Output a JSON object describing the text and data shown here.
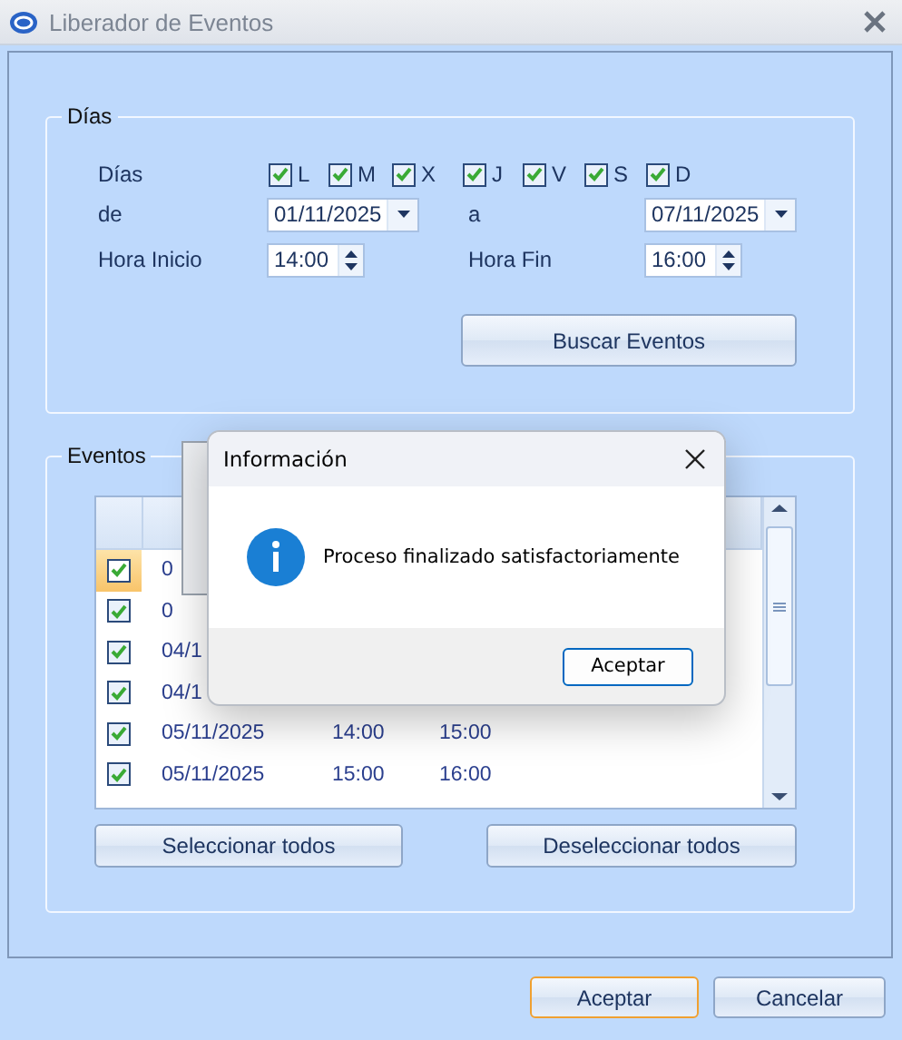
{
  "window": {
    "title": "Liberador de Eventos"
  },
  "dias_group": {
    "title": "Días",
    "days_label": "Días",
    "days": [
      {
        "label": "L",
        "checked": true
      },
      {
        "label": "M",
        "checked": true
      },
      {
        "label": "X",
        "checked": true
      },
      {
        "label": "J",
        "checked": true
      },
      {
        "label": "V",
        "checked": true
      },
      {
        "label": "S",
        "checked": true
      },
      {
        "label": "D",
        "checked": true
      }
    ],
    "from_label": "de",
    "from_date": "01/11/2025",
    "to_label": "a",
    "to_date": "07/11/2025",
    "start_label": "Hora Inicio",
    "start_time": "14:00",
    "end_label": "Hora Fin",
    "end_time": "16:00",
    "search_button": "Buscar Eventos"
  },
  "eventos_group": {
    "title": "Eventos",
    "rows": [
      {
        "selected": true,
        "checked": true,
        "date": "0"
      },
      {
        "selected": false,
        "checked": true,
        "date": "0"
      },
      {
        "selected": false,
        "checked": true,
        "date": "04/1"
      },
      {
        "selected": false,
        "checked": true,
        "date": "04/1"
      },
      {
        "selected": false,
        "checked": true,
        "date": "05/11/2025",
        "start": "14:00",
        "end": "15:00"
      },
      {
        "selected": false,
        "checked": true,
        "date": "05/11/2025",
        "start": "15:00",
        "end": "16:00"
      }
    ],
    "select_all_button": "Seleccionar todos",
    "deselect_all_button": "Deseleccionar todos"
  },
  "footer_buttons": [
    {
      "label": "Aceptar",
      "focused": true
    },
    {
      "label": "Cancelar",
      "focused": false
    }
  ],
  "message_box": {
    "title": "Información",
    "message": "Proceso finalizado satisfactoriamente",
    "button": "Aceptar"
  }
}
